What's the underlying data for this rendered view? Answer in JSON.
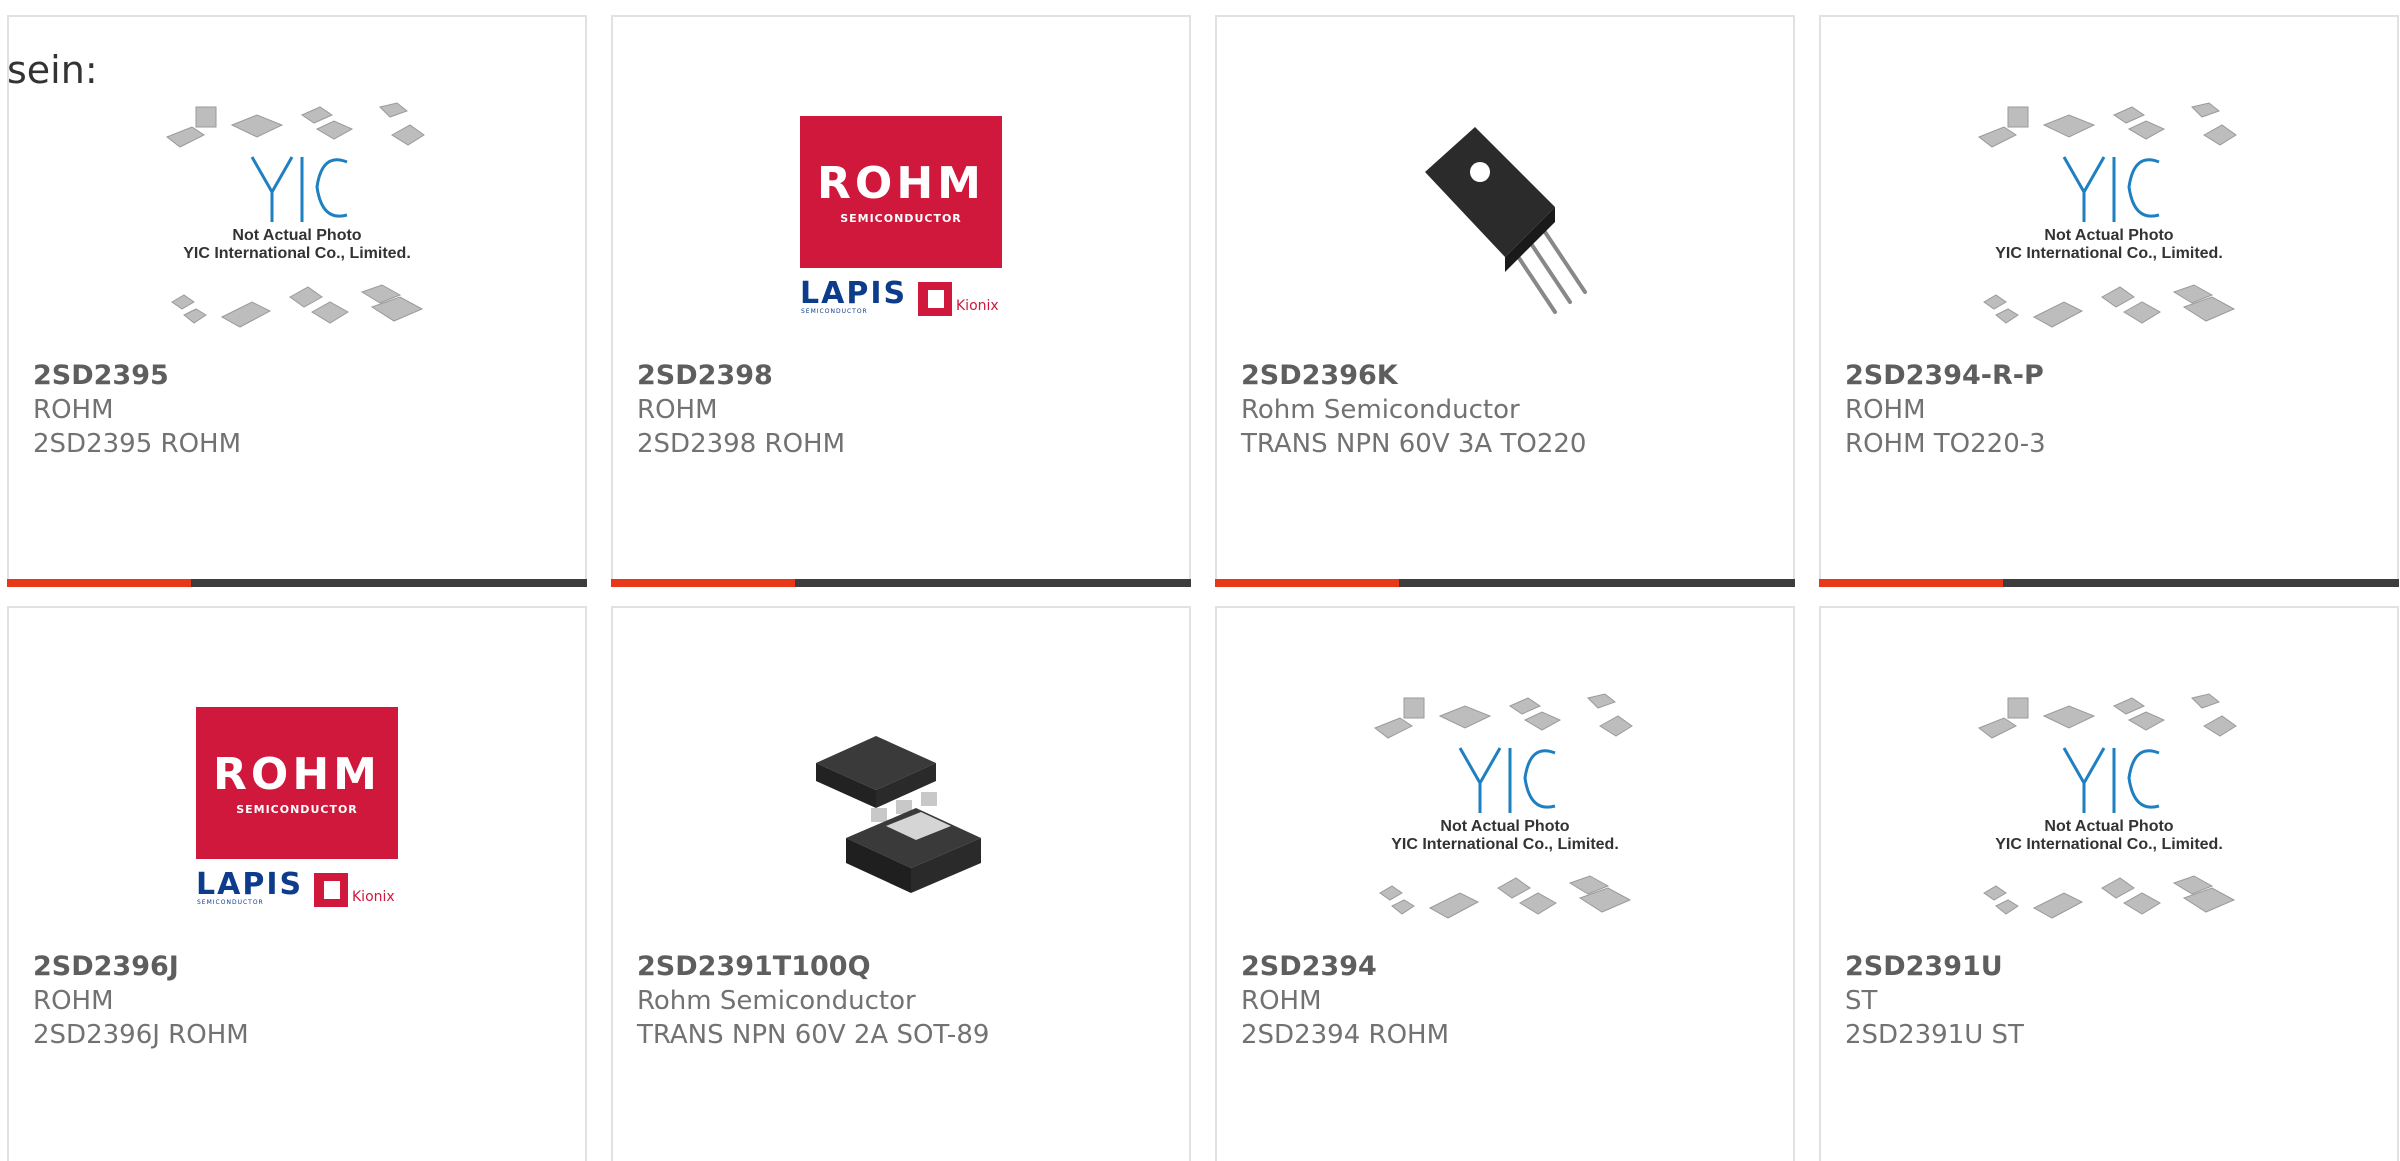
{
  "intro_text": "sein:",
  "placeholder": {
    "line1": "Not Actual Photo",
    "line2": "YIC International Co., Limited."
  },
  "logo": {
    "rohm": "ROHM",
    "rohm_sub": "SEMICONDUCTOR",
    "lapis": "LAPIS",
    "lapis_sub": "SEMICONDUCTOR",
    "kionix": "Kionix"
  },
  "colors": {
    "accent": "#e8381a",
    "bar": "#3d3d3d",
    "rohm_red": "#d0173c",
    "lapis_blue": "#0d3c8c"
  },
  "products": [
    {
      "part": "2SD2395",
      "manufacturer": "ROHM",
      "description": "2SD2395 ROHM",
      "image": "yic-placeholder-icon"
    },
    {
      "part": "2SD2398",
      "manufacturer": "ROHM",
      "description": "2SD2398 ROHM",
      "image": "rohm-logo-icon"
    },
    {
      "part": "2SD2396K",
      "manufacturer": "Rohm Semiconductor",
      "description": "TRANS NPN 60V 3A TO220",
      "image": "to220-package-icon"
    },
    {
      "part": "2SD2394-R-P",
      "manufacturer": "ROHM",
      "description": "ROHM TO220-3",
      "image": "yic-placeholder-icon"
    },
    {
      "part": "2SD2396J",
      "manufacturer": "ROHM",
      "description": "2SD2396J ROHM",
      "image": "rohm-logo-icon"
    },
    {
      "part": "2SD2391T100Q",
      "manufacturer": "Rohm Semiconductor",
      "description": "TRANS NPN 60V 2A SOT-89",
      "image": "sot89-package-icon"
    },
    {
      "part": "2SD2394",
      "manufacturer": "ROHM",
      "description": "2SD2394 ROHM",
      "image": "yic-placeholder-icon"
    },
    {
      "part": "2SD2391U",
      "manufacturer": "ST",
      "description": "2SD2391U ST",
      "image": "yic-placeholder-icon"
    }
  ]
}
